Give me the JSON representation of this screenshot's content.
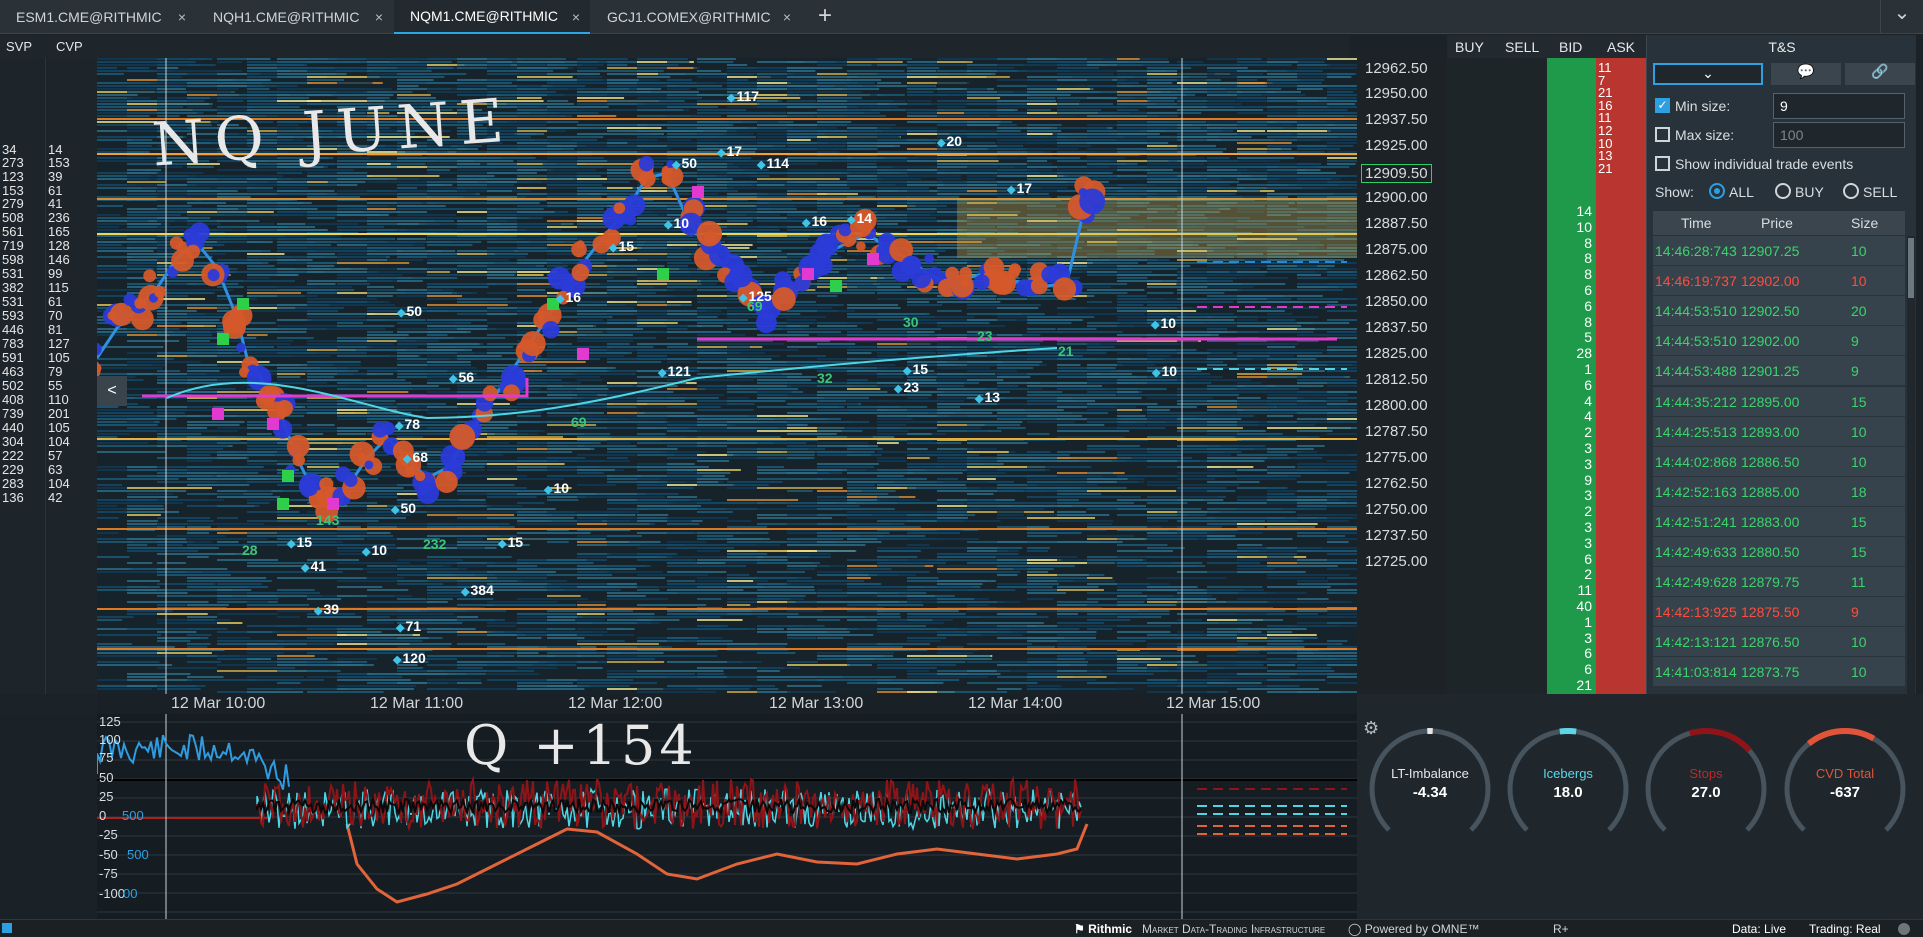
{
  "tabs": [
    {
      "label": "ESM1.CME@RITHMIC"
    },
    {
      "label": "NQH1.CME@RITHMIC"
    },
    {
      "label": "NQM1.CME@RITHMIC"
    },
    {
      "label": "GCJ1.COMEX@RITHMIC"
    }
  ],
  "tab_close": "×",
  "add_tab": "+",
  "menu_chevron": "⌄",
  "toolbar": {
    "svp": "SVP",
    "cvp": "CVP"
  },
  "annotations": {
    "title": "NQ JUNE",
    "cvd": "Q +154"
  },
  "left_volumes": [
    [
      "34",
      "14"
    ],
    [
      "273",
      "153"
    ],
    [
      "123",
      "39"
    ],
    [
      "153",
      "61"
    ],
    [
      "279",
      "41"
    ],
    [
      "508",
      "236"
    ],
    [
      "561",
      "165"
    ],
    [
      "719",
      "128"
    ],
    [
      "598",
      "146"
    ],
    [
      "531",
      "99"
    ],
    [
      "382",
      "115"
    ],
    [
      "531",
      "61"
    ],
    [
      "593",
      "70"
    ],
    [
      "446",
      "81"
    ],
    [
      "783",
      "127"
    ],
    [
      "591",
      "105"
    ],
    [
      "463",
      "79"
    ],
    [
      "502",
      "55"
    ],
    [
      "408",
      "110"
    ],
    [
      "739",
      "201"
    ],
    [
      "440",
      "105"
    ],
    [
      "304",
      "104"
    ],
    [
      "222",
      "57"
    ],
    [
      "229",
      "63"
    ],
    [
      "283",
      "104"
    ],
    [
      "136",
      "42"
    ]
  ],
  "collapse_arrow": "<",
  "price_axis": [
    "12962.50",
    "12950.00",
    "12937.50",
    "12925.00",
    "12909.50",
    "12900.00",
    "12887.50",
    "12875.00",
    "12862.50",
    "12850.00",
    "12837.50",
    "12825.00",
    "12812.50",
    "12800.00",
    "12787.50",
    "12775.00",
    "12762.50",
    "12750.00",
    "12737.50",
    "12725.00"
  ],
  "current_price": "12909.50",
  "ladder": {
    "buy": "BUY",
    "sell": "SELL",
    "bid": "BID",
    "ask": "ASK"
  },
  "bid_sizes": [
    "14",
    "10",
    "8",
    "8",
    "8",
    "6",
    "6",
    "8",
    "5",
    "28",
    "1",
    "6",
    "4",
    "4",
    "2",
    "3",
    "3",
    "9",
    "3",
    "2",
    "3",
    "3",
    "6",
    "2",
    "11",
    "40",
    "1",
    "3",
    "6",
    "6",
    "21"
  ],
  "ask_sizes": [
    "11",
    "7",
    "21",
    "16",
    "11",
    "12",
    "10",
    "13",
    "21"
  ],
  "ts": {
    "title": "T&S",
    "min_size_label": "Min size:",
    "min_size_value": "9",
    "max_size_label": "Max size:",
    "max_size_placeholder": "100",
    "show_individual": "Show individual trade events",
    "show_label": "Show:",
    "show_all": "ALL",
    "show_buy": "BUY",
    "show_sell": "SELL",
    "col_time": "Time",
    "col_price": "Price",
    "col_size": "Size",
    "rows": [
      {
        "time": "14:46:28:743",
        "price": "12907.25",
        "size": "10",
        "side": "buy"
      },
      {
        "time": "14:46:19:737",
        "price": "12902.00",
        "size": "10",
        "side": "sell"
      },
      {
        "time": "14:44:53:510",
        "price": "12902.50",
        "size": "20",
        "side": "buy"
      },
      {
        "time": "14:44:53:510",
        "price": "12902.00",
        "size": "9",
        "side": "buy"
      },
      {
        "time": "14:44:53:488",
        "price": "12901.25",
        "size": "9",
        "side": "buy"
      },
      {
        "time": "14:44:35:212",
        "price": "12895.00",
        "size": "15",
        "side": "buy"
      },
      {
        "time": "14:44:25:513",
        "price": "12893.00",
        "size": "10",
        "side": "buy"
      },
      {
        "time": "14:44:02:868",
        "price": "12886.50",
        "size": "10",
        "side": "buy"
      },
      {
        "time": "14:42:52:163",
        "price": "12885.00",
        "size": "18",
        "side": "buy"
      },
      {
        "time": "14:42:51:241",
        "price": "12883.00",
        "size": "15",
        "side": "buy"
      },
      {
        "time": "14:42:49:633",
        "price": "12880.50",
        "size": "15",
        "side": "buy"
      },
      {
        "time": "14:42:49:628",
        "price": "12879.75",
        "size": "11",
        "side": "buy"
      },
      {
        "time": "14:42:13:925",
        "price": "12875.50",
        "size": "9",
        "side": "sell"
      },
      {
        "time": "14:42:13:121",
        "price": "12876.50",
        "size": "10",
        "side": "buy"
      },
      {
        "time": "14:41:03:814",
        "price": "12873.75",
        "size": "10",
        "side": "buy"
      }
    ]
  },
  "time_axis": [
    "12 Mar 10:00",
    "12 Mar 11:00",
    "12 Mar 12:00",
    "12 Mar 13:00",
    "12 Mar 14:00",
    "12 Mar 15:00"
  ],
  "cvd_axis": [
    "125",
    "100",
    "75",
    "50",
    "25",
    "0",
    "-25",
    "-50",
    "-75",
    "-100"
  ],
  "cvd_axis_blue": [
    "500",
    "500",
    "00",
    "0"
  ],
  "gauges": [
    {
      "label": "LT-Imbalance",
      "value": "-4.34",
      "color": "#e6e6e6",
      "label_color": "#e6e6e6",
      "fill": 0.02
    },
    {
      "label": "Icebergs",
      "value": "18.0",
      "color": "#5fd6e8",
      "label_color": "#5fd6e8",
      "fill": 0.06
    },
    {
      "label": "Stops",
      "value": "27.0",
      "color": "#8e1418",
      "label_color": "#c0282a",
      "fill": 0.12
    },
    {
      "label": "CVD Total",
      "value": "-637",
      "color": "#e2543a",
      "label_color": "#e2543a",
      "fill": 0.22
    }
  ],
  "bubbles": [
    {
      "t": "117"
    },
    {
      "t": "50"
    },
    {
      "t": "17"
    },
    {
      "t": "114"
    },
    {
      "t": "20"
    },
    {
      "t": "17"
    },
    {
      "t": "10"
    },
    {
      "t": "16"
    },
    {
      "t": "14"
    },
    {
      "t": "15"
    },
    {
      "t": "16"
    },
    {
      "t": "50"
    },
    {
      "t": "56"
    },
    {
      "t": "78"
    },
    {
      "t": "68"
    },
    {
      "t": "10"
    },
    {
      "t": "50"
    },
    {
      "t": "10"
    },
    {
      "t": "15"
    },
    {
      "t": "15"
    },
    {
      "t": "41"
    },
    {
      "t": "384"
    },
    {
      "t": "39"
    },
    {
      "t": "71"
    },
    {
      "t": "120"
    },
    {
      "t": "121"
    },
    {
      "t": "23"
    },
    {
      "t": "15"
    },
    {
      "t": "13"
    },
    {
      "t": "10"
    },
    {
      "t": "10"
    },
    {
      "t": "125"
    }
  ],
  "green_labels": [
    "69",
    "30",
    "23",
    "21",
    "32",
    "143",
    "69",
    "232",
    "28"
  ],
  "status": {
    "brand": "Rithmic",
    "tagline": "Market Data-Trading Infrastructure",
    "powered": "Powered by OMNE™",
    "r": "R+",
    "data": "Data: Live",
    "trading": "Trading: Real"
  }
}
